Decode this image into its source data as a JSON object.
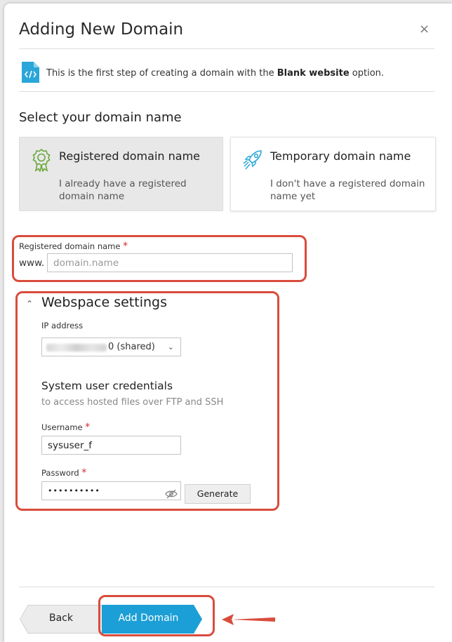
{
  "dialog": {
    "title": "Adding New Domain",
    "close_symbol": "×"
  },
  "info": {
    "icon": "code-file-icon",
    "text_before": "This is the first step of creating a domain with the ",
    "text_bold": "Blank website",
    "text_after": " option."
  },
  "domain_section": {
    "title": "Select your domain name",
    "options": [
      {
        "title": "Registered domain name",
        "description": "I already have a registered domain name",
        "icon": "award-badge-icon",
        "selected": true
      },
      {
        "title": "Temporary domain name",
        "description": "I don't have a registered domain name yet",
        "icon": "rocket-icon",
        "selected": false
      }
    ]
  },
  "domain_field": {
    "label": "Registered domain name",
    "required_mark": "*",
    "prefix": "www.",
    "placeholder": "domain.name",
    "value": ""
  },
  "webspace": {
    "title": "Webspace settings",
    "ip_label": "IP address",
    "ip_value": "0 (shared)",
    "credentials_title": "System user credentials",
    "credentials_subtitle": "to access hosted files over FTP and SSH",
    "username_label": "Username",
    "username_value": "sysuser_f",
    "password_label": "Password",
    "password_value": "••••••••••",
    "generate_label": "Generate",
    "required_mark": "*"
  },
  "footer": {
    "back_label": "Back",
    "add_label": "Add Domain"
  },
  "colors": {
    "primary_button": "#1c9fd6",
    "highlight": "#d94c3c",
    "required": "#d02c2c",
    "icon_green": "#6aa83a",
    "icon_blue": "#2aa6d9"
  }
}
